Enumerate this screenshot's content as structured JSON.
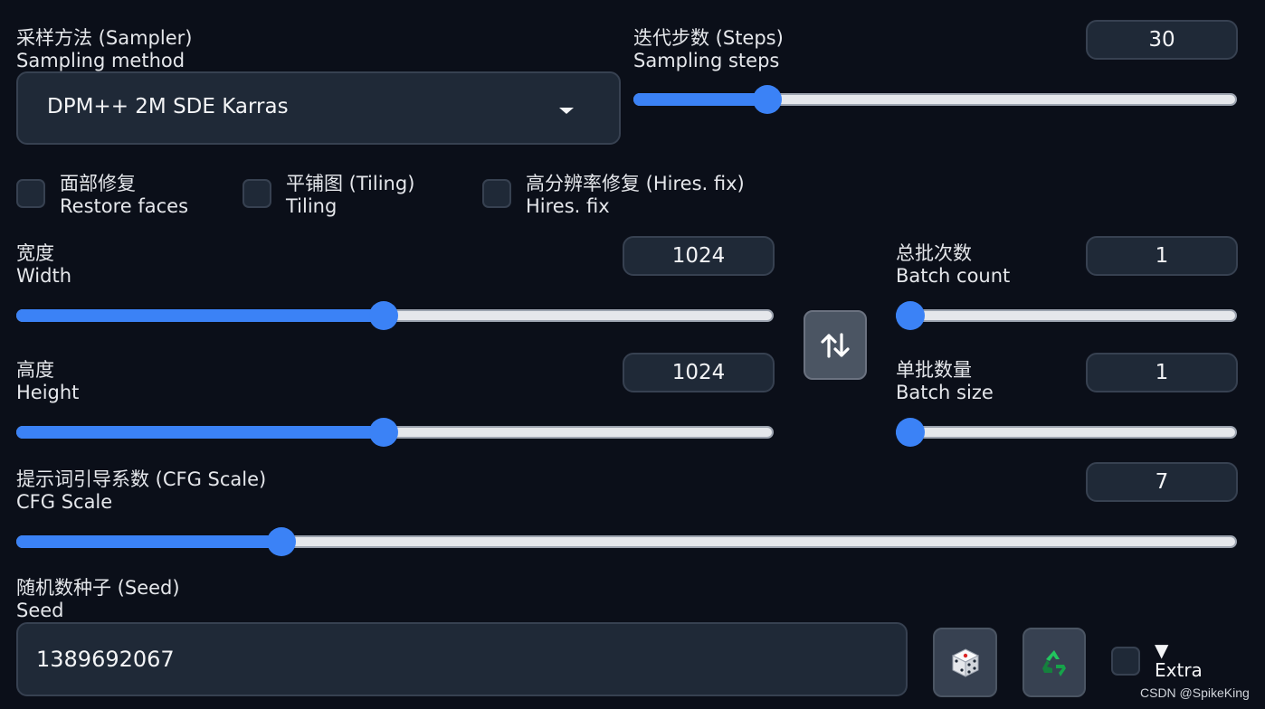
{
  "sampler": {
    "label_cn": "采样方法 (Sampler)",
    "label_en": "Sampling method",
    "value": "DPM++ 2M SDE Karras"
  },
  "steps": {
    "label_cn": "迭代步数 (Steps)",
    "label_en": "Sampling steps",
    "value": "30",
    "fraction": 0.208
  },
  "checkboxes": {
    "restore_faces": {
      "label_cn": "面部修复",
      "label_en": "Restore faces",
      "checked": false
    },
    "tiling": {
      "label_cn": "平铺图 (Tiling)",
      "label_en": "Tiling",
      "checked": false
    },
    "hires_fix": {
      "label_cn": "高分辨率修复 (Hires. fix)",
      "label_en": "Hires. fix",
      "checked": false
    }
  },
  "width": {
    "label_cn": "宽度",
    "label_en": "Width",
    "value": "1024",
    "fraction": 0.485
  },
  "height": {
    "label_cn": "高度",
    "label_en": "Height",
    "value": "1024",
    "fraction": 0.485
  },
  "swap_icon": "swap-vertical-arrows-icon",
  "batch_count": {
    "label_cn": "总批次数",
    "label_en": "Batch count",
    "value": "1",
    "fraction": 0
  },
  "batch_size": {
    "label_cn": "单批数量",
    "label_en": "Batch size",
    "value": "1",
    "fraction": 0
  },
  "cfg": {
    "label_cn": "提示词引导系数 (CFG Scale)",
    "label_en": "CFG Scale",
    "value": "7",
    "fraction": 0.21
  },
  "seed": {
    "label_cn": "随机数种子 (Seed)",
    "label_en": "Seed",
    "value": "1389692067",
    "random_icon": "dice-icon",
    "reuse_icon": "recycle-icon"
  },
  "extra": {
    "arrow": "▼",
    "label": "Extra",
    "checked": false
  },
  "watermark": "CSDN @SpikeKing",
  "colors": {
    "background": "#0b0f19",
    "accent": "#3b82f6",
    "field": "#1f2937"
  }
}
